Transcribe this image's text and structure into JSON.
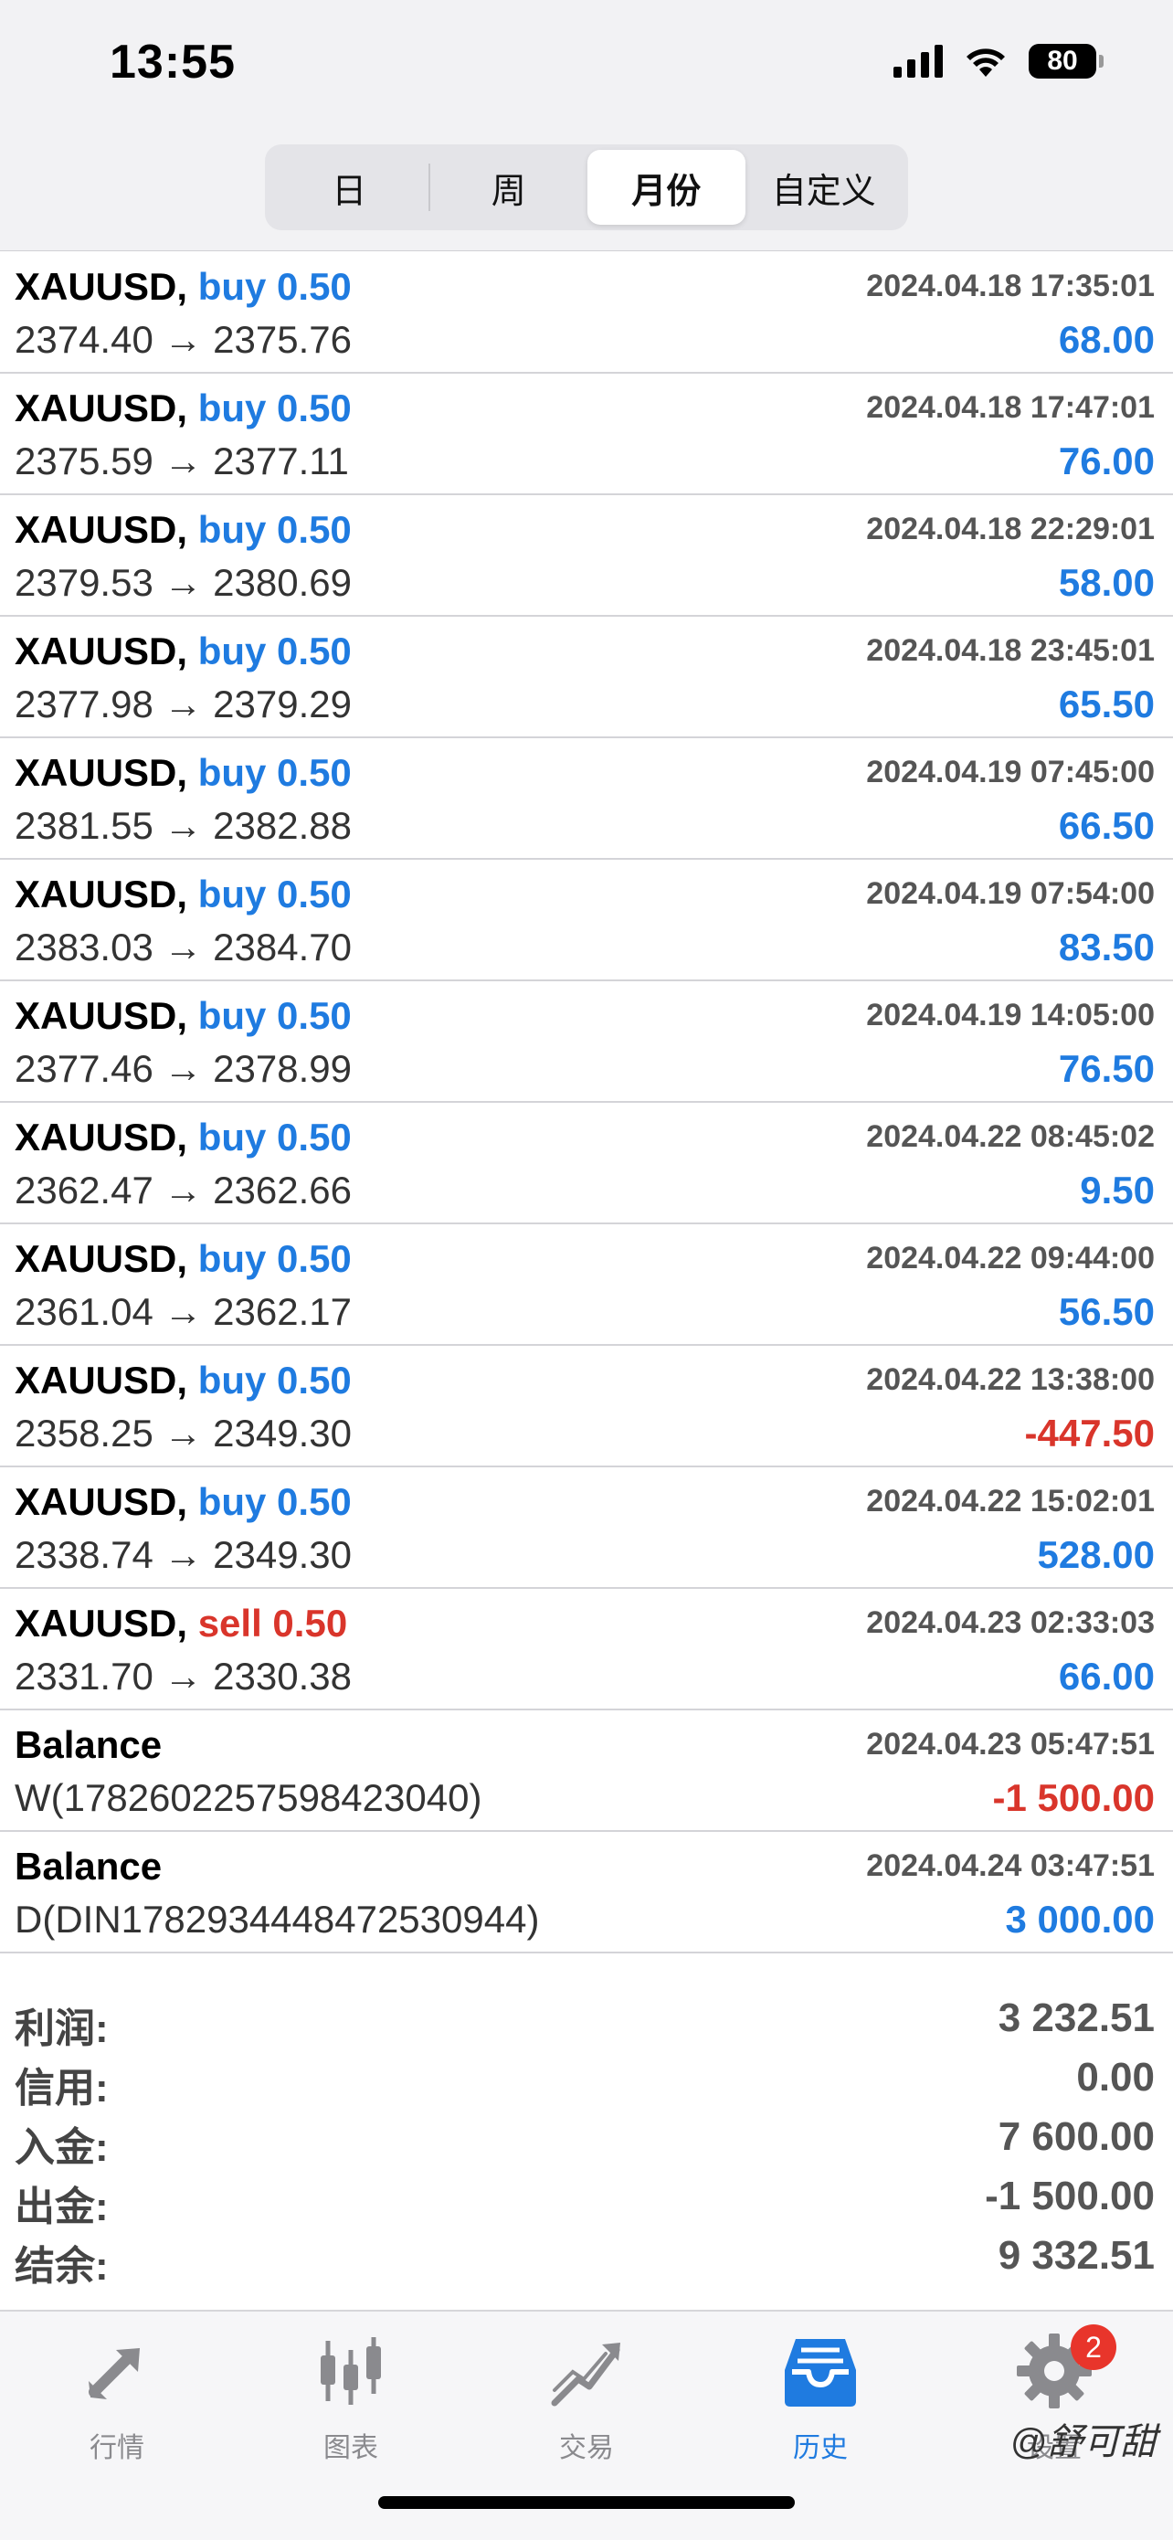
{
  "status_bar": {
    "time": "13:55",
    "battery": "80"
  },
  "segments": {
    "items": [
      {
        "label": "日"
      },
      {
        "label": "周"
      },
      {
        "label": "月份"
      },
      {
        "label": "自定义"
      }
    ],
    "active": "月份"
  },
  "trades": [
    {
      "symbol": "XAUUSD,",
      "side": "buy 0.50",
      "type": "buy",
      "prices": "2374.40 → 2375.76",
      "time": "2024.04.18 17:35:01",
      "profit": "68.00",
      "sign": "pos"
    },
    {
      "symbol": "XAUUSD,",
      "side": "buy 0.50",
      "type": "buy",
      "prices": "2375.59 → 2377.11",
      "time": "2024.04.18 17:47:01",
      "profit": "76.00",
      "sign": "pos"
    },
    {
      "symbol": "XAUUSD,",
      "side": "buy 0.50",
      "type": "buy",
      "prices": "2379.53 → 2380.69",
      "time": "2024.04.18 22:29:01",
      "profit": "58.00",
      "sign": "pos"
    },
    {
      "symbol": "XAUUSD,",
      "side": "buy 0.50",
      "type": "buy",
      "prices": "2377.98 → 2379.29",
      "time": "2024.04.18 23:45:01",
      "profit": "65.50",
      "sign": "pos"
    },
    {
      "symbol": "XAUUSD,",
      "side": "buy 0.50",
      "type": "buy",
      "prices": "2381.55 → 2382.88",
      "time": "2024.04.19 07:45:00",
      "profit": "66.50",
      "sign": "pos"
    },
    {
      "symbol": "XAUUSD,",
      "side": "buy 0.50",
      "type": "buy",
      "prices": "2383.03 → 2384.70",
      "time": "2024.04.19 07:54:00",
      "profit": "83.50",
      "sign": "pos"
    },
    {
      "symbol": "XAUUSD,",
      "side": "buy 0.50",
      "type": "buy",
      "prices": "2377.46 → 2378.99",
      "time": "2024.04.19 14:05:00",
      "profit": "76.50",
      "sign": "pos"
    },
    {
      "symbol": "XAUUSD,",
      "side": "buy 0.50",
      "type": "buy",
      "prices": "2362.47 → 2362.66",
      "time": "2024.04.22 08:45:02",
      "profit": "9.50",
      "sign": "pos"
    },
    {
      "symbol": "XAUUSD,",
      "side": "buy 0.50",
      "type": "buy",
      "prices": "2361.04 → 2362.17",
      "time": "2024.04.22 09:44:00",
      "profit": "56.50",
      "sign": "pos"
    },
    {
      "symbol": "XAUUSD,",
      "side": "buy 0.50",
      "type": "buy",
      "prices": "2358.25 → 2349.30",
      "time": "2024.04.22 13:38:00",
      "profit": "-447.50",
      "sign": "neg"
    },
    {
      "symbol": "XAUUSD,",
      "side": "buy 0.50",
      "type": "buy",
      "prices": "2338.74 → 2349.30",
      "time": "2024.04.22 15:02:01",
      "profit": "528.00",
      "sign": "pos"
    },
    {
      "symbol": "XAUUSD,",
      "side": "sell 0.50",
      "type": "sell",
      "prices": "2331.70 → 2330.38",
      "time": "2024.04.23 02:33:03",
      "profit": "66.00",
      "sign": "pos"
    },
    {
      "symbol": "Balance",
      "side": "",
      "type": "balance",
      "prices": "W(1782602257598423040)",
      "time": "2024.04.23 05:47:51",
      "profit": "-1 500.00",
      "sign": "neg"
    },
    {
      "symbol": "Balance",
      "side": "",
      "type": "balance",
      "prices": "D(DIN1782934448472530944)",
      "time": "2024.04.24 03:47:51",
      "profit": "3 000.00",
      "sign": "pos"
    }
  ],
  "summary": [
    {
      "label": "利润:",
      "value": "3 232.51"
    },
    {
      "label": "信用:",
      "value": "0.00"
    },
    {
      "label": "入金:",
      "value": "7 600.00"
    },
    {
      "label": "出金:",
      "value": "-1 500.00"
    },
    {
      "label": "结余:",
      "value": "9 332.51"
    }
  ],
  "tabs": [
    {
      "label": "行情",
      "icon": "quotes-icon"
    },
    {
      "label": "图表",
      "icon": "candlestick-chart-icon"
    },
    {
      "label": "交易",
      "icon": "trade-icon"
    },
    {
      "label": "历史",
      "icon": "history-inbox-icon"
    },
    {
      "label": "设置",
      "icon": "gear-icon",
      "badge": "2"
    }
  ],
  "active_tab": "历史",
  "watermark": "@舒可甜",
  "colors": {
    "positive": "#1f7be0",
    "negative": "#d9352b",
    "tab_active": "#1f7be0",
    "tab_inactive": "#8a8a8e",
    "badge": "#e8352b"
  }
}
